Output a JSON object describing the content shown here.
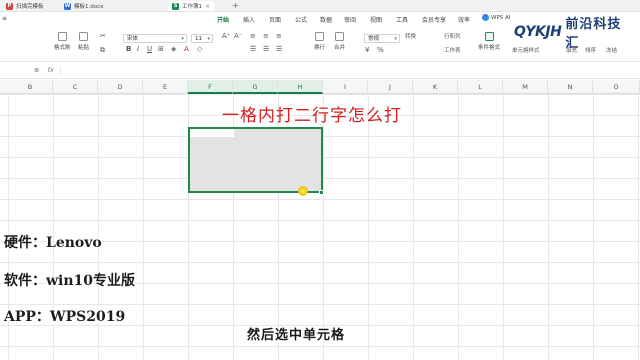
{
  "doc_tabs": [
    {
      "label": "扫描完模板",
      "icon": "pdf-icon",
      "color": "#e0453a"
    },
    {
      "label": "模板1.docx",
      "icon": "word-icon",
      "color": "#2f6fe0"
    },
    {
      "label": "工作簿1",
      "icon": "sheet-icon",
      "color": "#1b8a4c"
    }
  ],
  "ribbon_tabs": [
    "开始",
    "插入",
    "页面",
    "公式",
    "数据",
    "审阅",
    "视图",
    "工具",
    "会员专享",
    "效率"
  ],
  "active_ribbon_tab": "开始",
  "ai_button": "WPS AI",
  "logo": {
    "mark": "QYKJH",
    "text": "前沿科技汇"
  },
  "toolbar": {
    "format_painter": "格式刷",
    "paste": "粘贴",
    "font_name": "宋体",
    "font_size": "11",
    "wrap": "换行",
    "merge": "合并",
    "number_format": "常规",
    "convert": "转换",
    "rows_cols": "行和列",
    "worksheet": "工作表",
    "conditional_format": "条件格式",
    "cell_style": "单元格样式",
    "fill": "填充",
    "sort": "排序",
    "freeze": "冻结"
  },
  "formula_bar": {
    "name_box": "",
    "formula": ""
  },
  "columns": [
    "B",
    "C",
    "D",
    "E",
    "F",
    "G",
    "H",
    "I",
    "J",
    "K",
    "L",
    "M",
    "N",
    "O"
  ],
  "selected_columns": [
    "F",
    "G",
    "H"
  ],
  "headline": "一格内打二行字怎么打",
  "captions": {
    "hardware": "硬件：Lenovo",
    "software": "软件：win10专业版",
    "app": "APP：WPS2019"
  },
  "subtitle": "然后选中单元格",
  "colors": {
    "accent": "#1b7a46",
    "headline": "#d51f1f",
    "selection_border": "#1f8a4c"
  }
}
